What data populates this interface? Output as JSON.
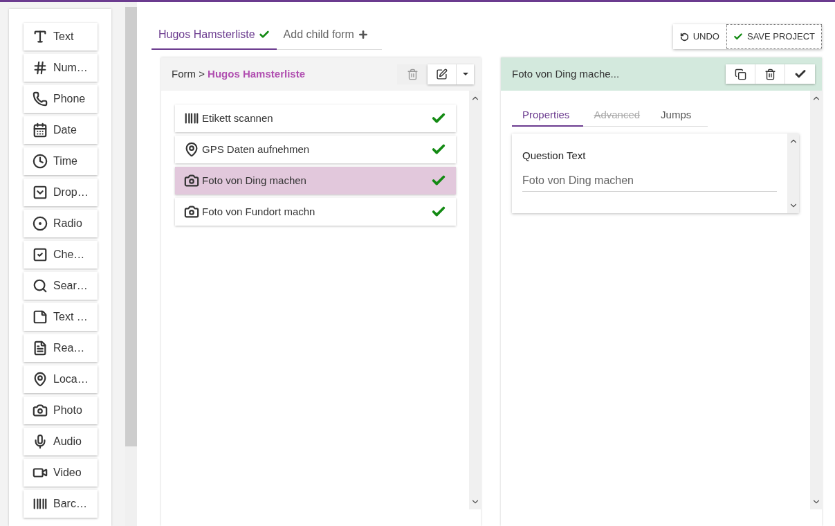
{
  "palette": [
    {
      "label": "Text",
      "kind": "text"
    },
    {
      "label": "Num…",
      "kind": "number"
    },
    {
      "label": "Phone",
      "kind": "phone"
    },
    {
      "label": "Date",
      "kind": "date"
    },
    {
      "label": "Time",
      "kind": "time"
    },
    {
      "label": "Drop…",
      "kind": "dropdown"
    },
    {
      "label": "Radio",
      "kind": "radio"
    },
    {
      "label": "Che…",
      "kind": "checkbox"
    },
    {
      "label": "Sear…",
      "kind": "search"
    },
    {
      "label": "Text …",
      "kind": "note"
    },
    {
      "label": "Rea…",
      "kind": "document"
    },
    {
      "label": "Loca…",
      "kind": "location"
    },
    {
      "label": "Photo",
      "kind": "photo"
    },
    {
      "label": "Audio",
      "kind": "audio"
    },
    {
      "label": "Video",
      "kind": "video"
    },
    {
      "label": "Barc…",
      "kind": "barcode"
    }
  ],
  "form_tabs": [
    {
      "label": "Hugos Hamsterliste",
      "kind": "form",
      "selected": true
    },
    {
      "label": "Add child form",
      "kind": "add",
      "selected": false
    }
  ],
  "toolbar": {
    "undo": "UNDO",
    "save": "SAVE PROJECT"
  },
  "form_panel": {
    "breadcrumb_prefix": "Form >",
    "breadcrumb_name": "Hugos Hamsterliste",
    "questions": [
      {
        "label": "Etikett scannen",
        "kind": "barcode",
        "selected": false,
        "valid": true
      },
      {
        "label": "GPS Daten aufnehmen",
        "kind": "location",
        "selected": false,
        "valid": true
      },
      {
        "label": "Foto von Ding machen",
        "kind": "photo",
        "selected": true,
        "valid": true
      },
      {
        "label": "Foto von Fundort machn",
        "kind": "photo",
        "selected": false,
        "valid": true
      }
    ]
  },
  "question_panel": {
    "title": "Foto von Ding mache...",
    "tabs": [
      {
        "label": "Properties",
        "selected": true,
        "disabled": false
      },
      {
        "label": "Advanced",
        "selected": false,
        "disabled": true
      },
      {
        "label": "Jumps",
        "selected": false,
        "disabled": false
      }
    ],
    "field_label": "Question Text",
    "field_value": "Foto von Ding machen"
  }
}
